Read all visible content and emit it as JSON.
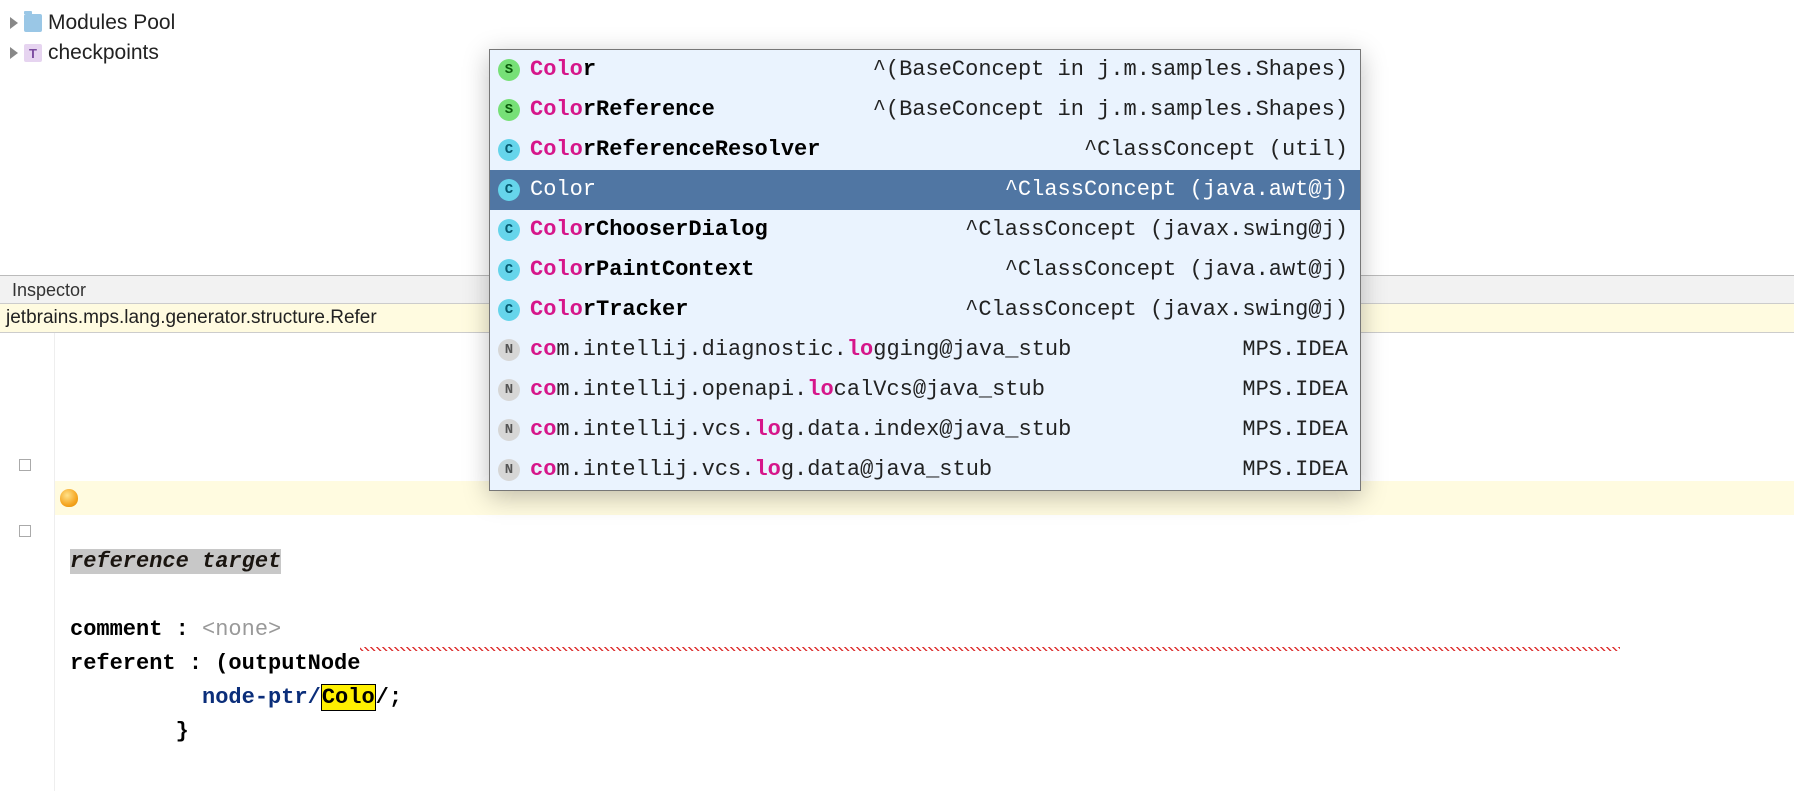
{
  "tree": {
    "items": [
      {
        "label": "Modules Pool",
        "iconType": "folder"
      },
      {
        "label": "checkpoints",
        "iconType": "t"
      }
    ]
  },
  "inspector": {
    "title": "Inspector",
    "breadcrumb": "jetbrains.mps.lang.generator.structure.Refer",
    "refTarget": "reference target",
    "commentLabel": "comment : ",
    "commentValue": "<none>",
    "referentLabel": "referent : ",
    "referentSig": "(outputNode",
    "nodePtrKw": "node-ptr/",
    "typed": "Colo",
    "afterTyped": "/;",
    "closeBrace": "}"
  },
  "popup": {
    "items": [
      {
        "icon": "s",
        "prefix": "Colo",
        "rest": "r",
        "hint": "^(BaseConcept in j.m.samples.Shapes)",
        "selected": false
      },
      {
        "icon": "s",
        "prefix": "Colo",
        "rest": "rReference",
        "hint": "^(BaseConcept in j.m.samples.Shapes)",
        "selected": false
      },
      {
        "icon": "c",
        "prefix": "Colo",
        "rest": "rReferenceResolver",
        "hint": "^ClassConcept (util)",
        "selected": false
      },
      {
        "icon": "c",
        "prefix": "Color",
        "rest": "",
        "hint": "^ClassConcept (java.awt@j)",
        "selected": true
      },
      {
        "icon": "c",
        "prefix": "Colo",
        "rest": "rChooserDialog",
        "hint": "^ClassConcept (javax.swing@j)",
        "selected": false
      },
      {
        "icon": "c",
        "prefix": "Colo",
        "rest": "rPaintContext",
        "hint": "^ClassConcept (java.awt@j)",
        "selected": false
      },
      {
        "icon": "c",
        "prefix": "Colo",
        "rest": "rTracker",
        "hint": "^ClassConcept (javax.swing@j)",
        "selected": false
      },
      {
        "icon": "n",
        "segments": [
          "co",
          "m.intellij.diagnostic.",
          "lo",
          "gging@java_stub"
        ],
        "hint": "MPS.IDEA",
        "selected": false
      },
      {
        "icon": "n",
        "segments": [
          "co",
          "m.intellij.openapi.",
          "lo",
          "calVcs@java_stub"
        ],
        "hint": "MPS.IDEA",
        "selected": false
      },
      {
        "icon": "n",
        "segments": [
          "co",
          "m.intellij.vcs.",
          "lo",
          "g.data.index@java_stub"
        ],
        "hint": "MPS.IDEA",
        "selected": false
      },
      {
        "icon": "n",
        "segments": [
          "co",
          "m.intellij.vcs.",
          "lo",
          "g.data@java_stub"
        ],
        "hint": "MPS.IDEA",
        "selected": false
      }
    ]
  }
}
